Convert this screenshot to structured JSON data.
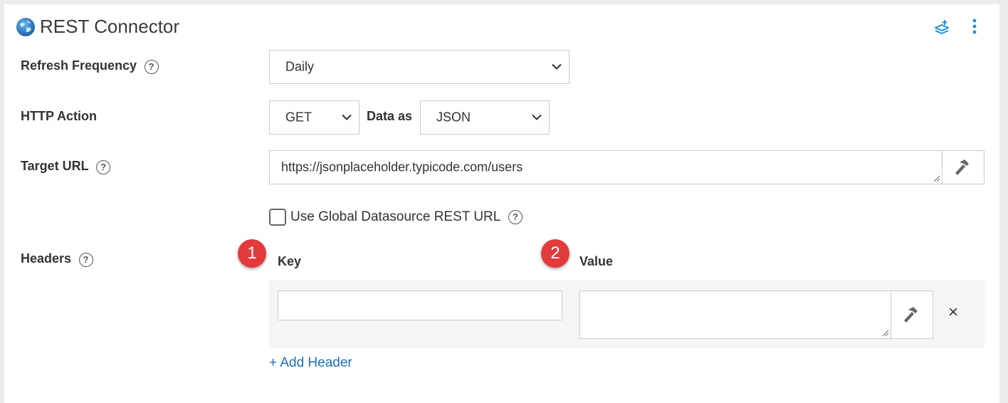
{
  "header": {
    "title": "REST Connector"
  },
  "form": {
    "refresh_frequency": {
      "label": "Refresh Frequency",
      "value": "Daily"
    },
    "http_action": {
      "label": "HTTP Action",
      "value": "GET"
    },
    "data_as": {
      "label": "Data as",
      "value": "JSON"
    },
    "target_url": {
      "label": "Target URL",
      "value": "https://jsonplaceholder.typicode.com/users"
    },
    "global_datasource": {
      "label": "Use Global Datasource REST URL",
      "checked": false
    },
    "headers": {
      "label": "Headers",
      "key_column": "Key",
      "value_column": "Value",
      "rows": [
        {
          "key": "",
          "value": ""
        }
      ],
      "add_label": "+ Add Header"
    }
  },
  "annotations": [
    "1",
    "2"
  ],
  "help_glyph": "?",
  "remove_glyph": "×",
  "colors": {
    "accent": "#1e8fd6",
    "link": "#1d6fc2",
    "badge": "#e23b3b"
  }
}
